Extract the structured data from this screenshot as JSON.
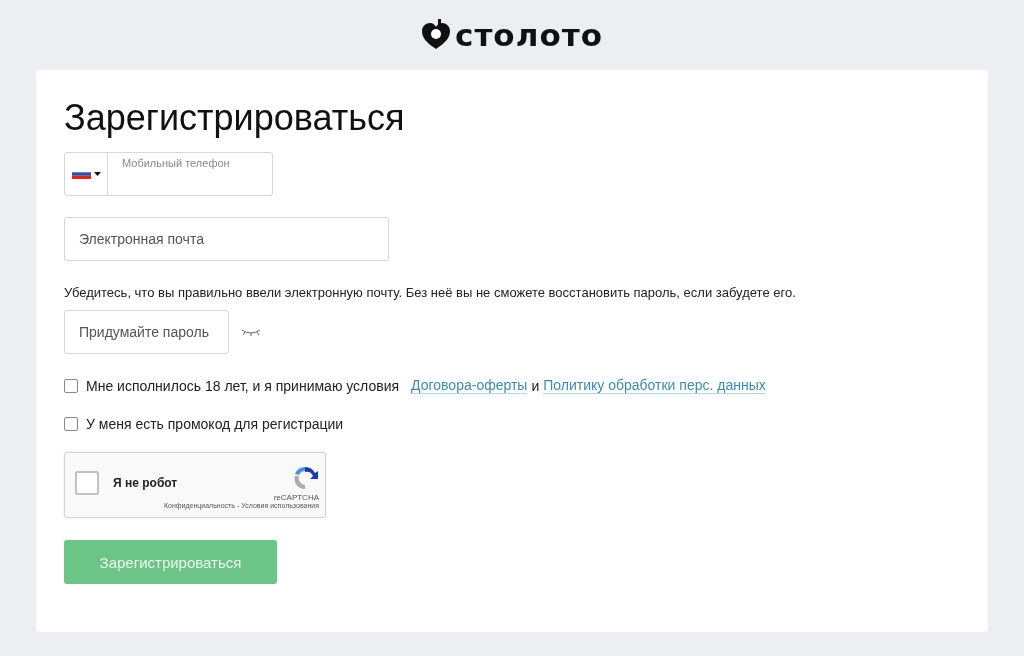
{
  "logo": {
    "text": "столото"
  },
  "title": "Зарегистрироваться",
  "phone": {
    "placeholder": "Мобильный телефон"
  },
  "email": {
    "placeholder": "Электронная почта"
  },
  "email_hint": "Убедитесь, что вы правильно ввели электронную почту. Без неё вы не сможете восстановить пароль, если забудете его.",
  "password": {
    "placeholder": "Придумайте пароль"
  },
  "agreement": {
    "checked": false,
    "text": "Мне исполнилось 18 лет, и я принимаю условия",
    "link_1": "Договора-оферты",
    "joiner": "и",
    "link_2": "Политику обработки перс. данных"
  },
  "promo": {
    "checked": false,
    "text": "У меня есть промокод для регистрации"
  },
  "captcha": {
    "checked": false,
    "label": "Я не робот",
    "brand": "reCAPTCHA",
    "privacy": "Конфиденциальность",
    "separator": "-",
    "terms": "Условия использования"
  },
  "submit": {
    "label": "Зарегистрироваться",
    "disabled": true
  }
}
